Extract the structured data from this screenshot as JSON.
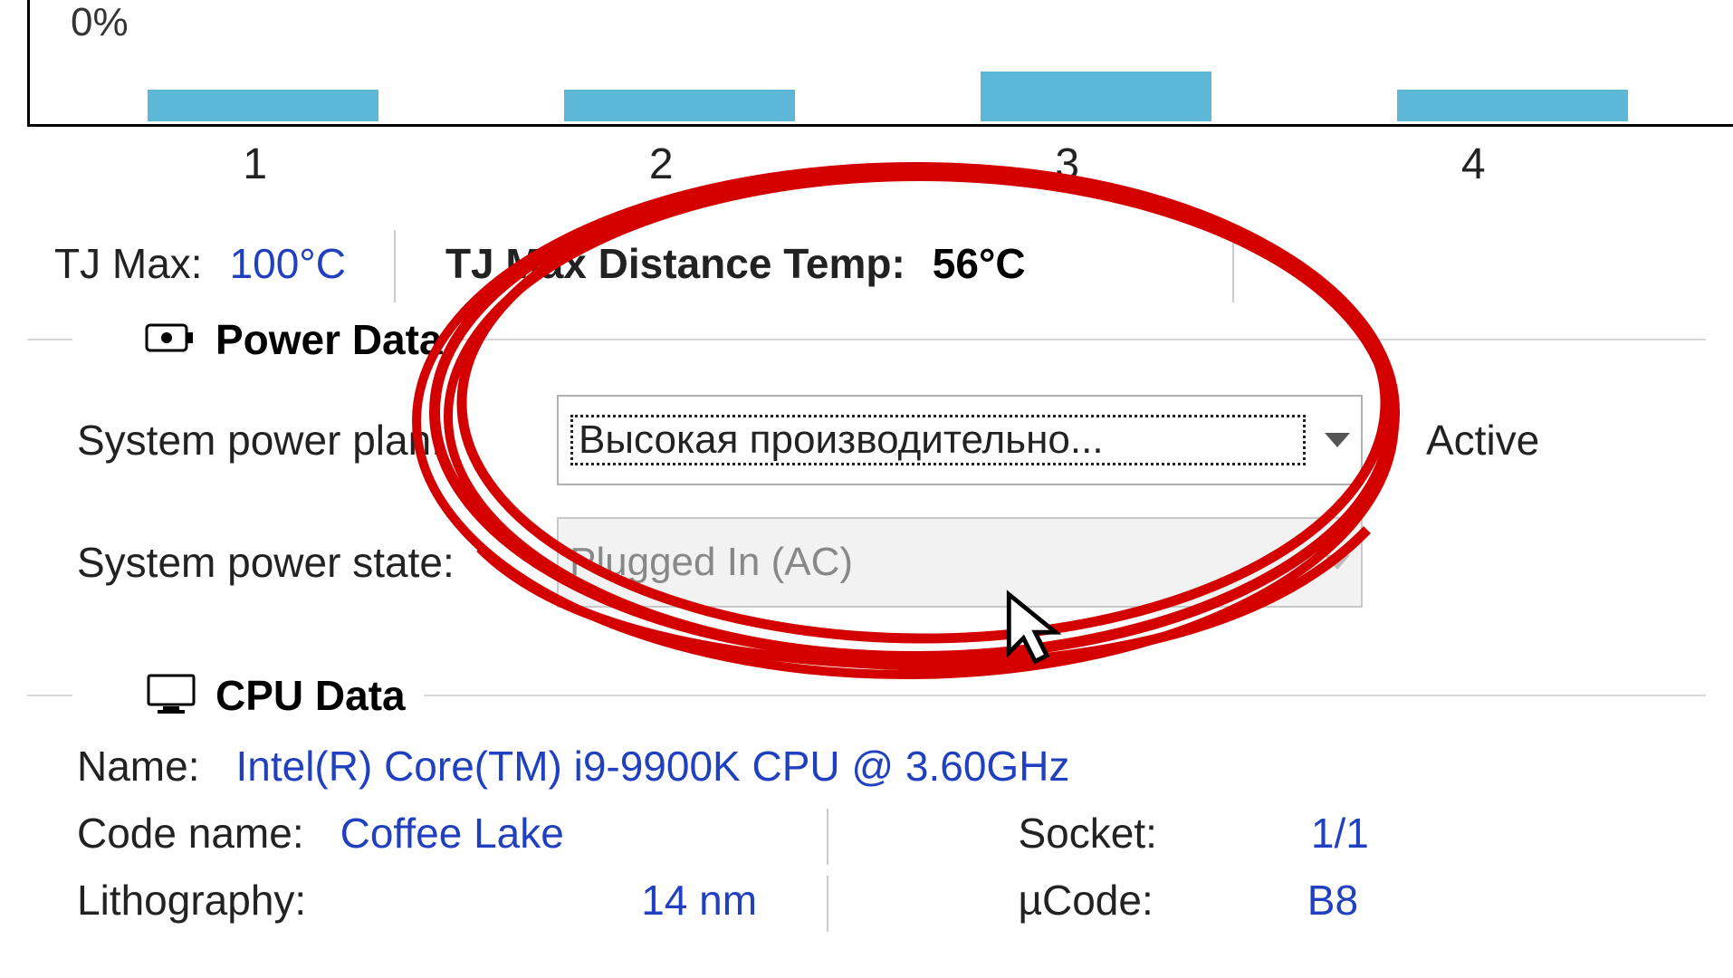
{
  "chart_data": {
    "type": "bar",
    "categories": [
      "1",
      "2",
      "3",
      "4"
    ],
    "values": [
      5,
      5,
      9,
      5
    ],
    "ylabel": "0%",
    "ylim": [
      0,
      100
    ]
  },
  "temp_row": {
    "tj_max_label": "TJ Max:",
    "tj_max_value": "100°C",
    "tj_dist_label": "TJ Max Distance Temp:",
    "tj_dist_value": "56°C"
  },
  "power": {
    "section_title": "Power Data",
    "plan_label": "System power plan:",
    "plan_value": "Высокая производительно...",
    "plan_status": "Active",
    "state_label": "System power state:",
    "state_value": "Plugged In (AC)"
  },
  "cpu": {
    "section_title": "CPU Data",
    "name_label": "Name:",
    "name_value": "Intel(R) Core(TM) i9-9900K CPU @ 3.60GHz",
    "code_label": "Code name:",
    "code_value": "Coffee Lake",
    "socket_label": "Socket:",
    "socket_value": "1/1",
    "litho_label": "Lithography:",
    "litho_value": "14 nm",
    "ucode_label": "µCode:",
    "ucode_value": "B8"
  }
}
